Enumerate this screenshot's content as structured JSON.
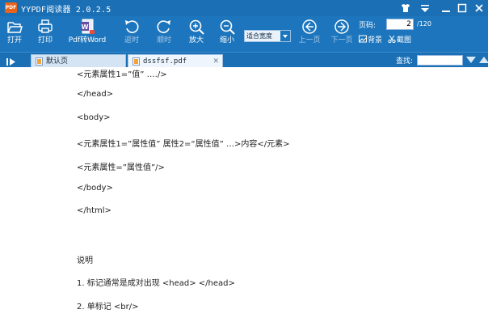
{
  "app": {
    "logo_text": "PDF",
    "title": "YYPDF阅读器 2.0.2.5"
  },
  "toolbar": {
    "open": "打开",
    "print": "打印",
    "to_word": "Pdf转Word",
    "undo": "返时",
    "redo": "顺时",
    "zoom_in": "放大",
    "zoom_out": "缩小",
    "zoom_mode": "适合宽度",
    "prev_page": "上一页",
    "next_page": "下一页",
    "page_label": "页码:",
    "page_current": "2",
    "page_total": "/120",
    "background": "背景",
    "screenshot": "截图"
  },
  "tabs": [
    {
      "label": "默认页"
    },
    {
      "label": "dssfsf.pdf"
    }
  ],
  "find": {
    "label": "查找:",
    "value": ""
  },
  "document": {
    "lines": [
      "<元素属性1=”值” …./>",
      "</head>",
      "<body>",
      "<元素属性1=”属性值” 属性2=“属性值” …>内容</元素>",
      "<元素属性=”属性值”/>",
      "</body>",
      "</html>",
      "说明",
      "1. 标记通常是成对出现 <head> </head>",
      "2. 单标记 <br/>"
    ]
  },
  "colors": {
    "titlebar": "#1a6fb5",
    "toolbar": "#1d76bd",
    "logo": "#e8641b",
    "disabled_label": "#a9c9e8"
  }
}
